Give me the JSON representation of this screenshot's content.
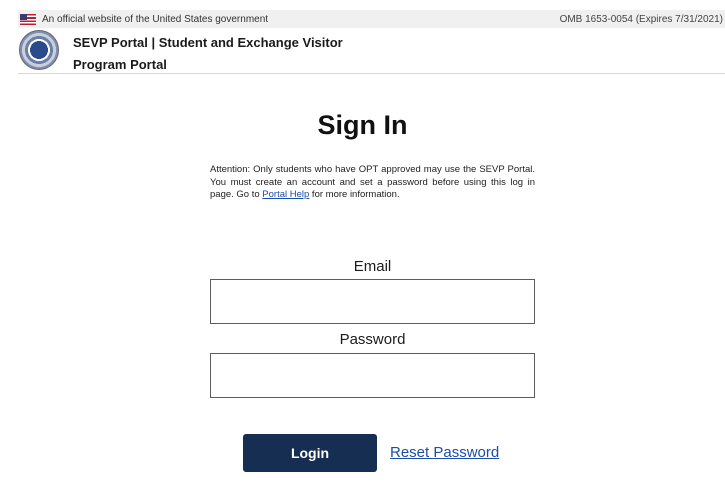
{
  "gov_banner": {
    "text": "An official website of the United States government",
    "omb": "OMB 1653-0054 (Expires 7/31/2021)"
  },
  "header": {
    "title": "SEVP Portal | Student and Exchange Visitor Program Portal",
    "seal_icon": "dhs-seal-icon"
  },
  "signin": {
    "title": "Sign In",
    "attention_text": "Attention: Only students who have OPT approved may use the SEVP Portal. You must create an account and set a password before using this log in page. Go to ",
    "portal_help_link": "Portal Help",
    "attention_tail": " for more information.",
    "email_label": "Email",
    "email_value": "",
    "password_label": "Password",
    "password_value": "",
    "login_button": "Login",
    "reset_link": "Reset Password"
  },
  "colors": {
    "primary_button": "#162e51",
    "link": "#1a4ea8",
    "banner_bg": "#f0f0f0"
  }
}
